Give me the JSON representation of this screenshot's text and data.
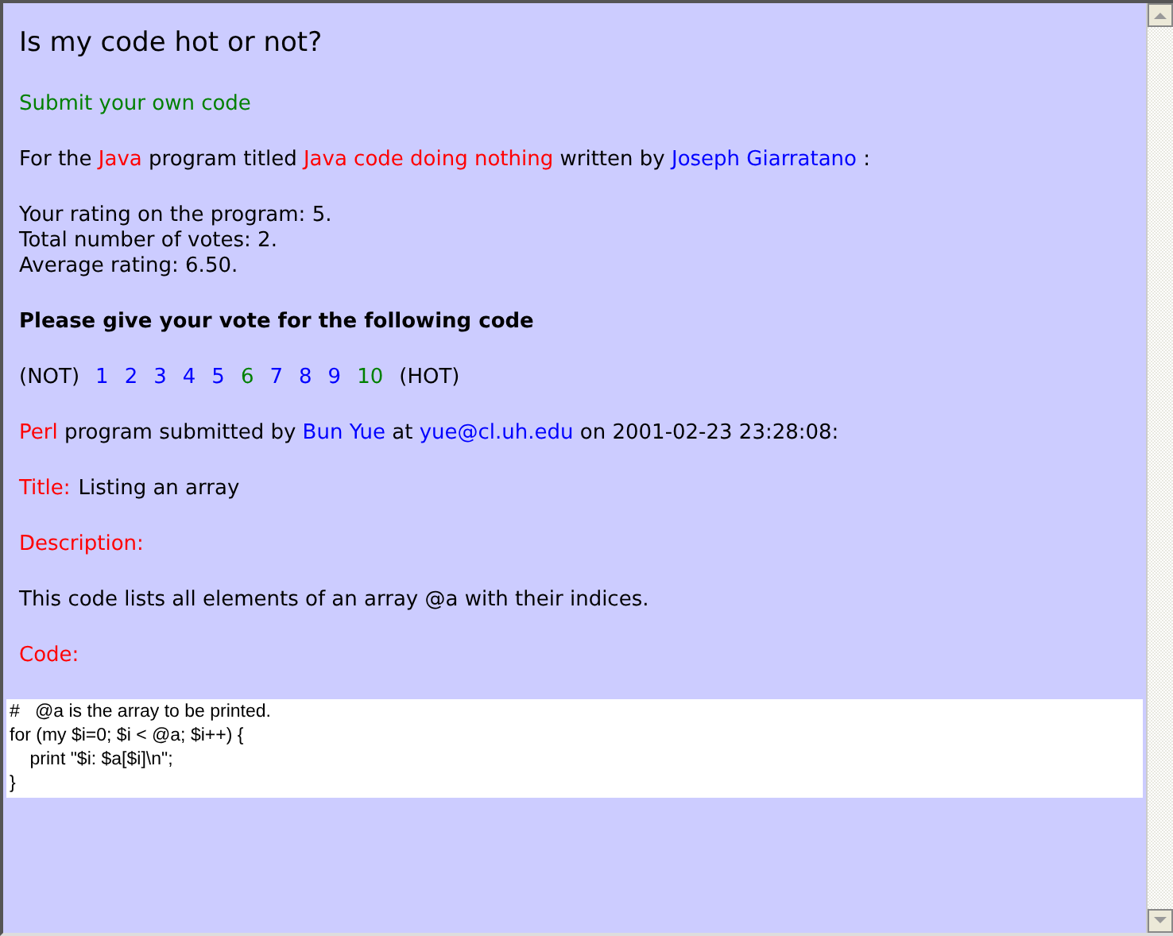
{
  "heading": "Is my code hot or not?",
  "submit_link": "Submit your own code",
  "intro": [
    {
      "kind": "text",
      "text": "For the "
    },
    {
      "kind": "red",
      "text": "Java"
    },
    {
      "kind": "text",
      "text": " program titled "
    },
    {
      "kind": "red",
      "text": "Java code doing nothing"
    },
    {
      "kind": "text",
      "text": " written by "
    },
    {
      "kind": "link",
      "text": "Joseph Giarratano"
    },
    {
      "kind": "text",
      "text": " :"
    }
  ],
  "stats": [
    "Your rating on the program: 5.",
    "Total number of votes: 2.",
    "Average rating: 6.50."
  ],
  "vote_prompt": "Please give your vote for the following code",
  "vote_low": "(NOT)",
  "votes": [
    {
      "label": "1",
      "color": "#0000ff"
    },
    {
      "label": "2",
      "color": "#0000ff"
    },
    {
      "label": "3",
      "color": "#0000ff"
    },
    {
      "label": "4",
      "color": "#0000ff"
    },
    {
      "label": "5",
      "color": "#0000ff"
    },
    {
      "label": "6",
      "color": "#008000"
    },
    {
      "label": "7",
      "color": "#0000ff"
    },
    {
      "label": "8",
      "color": "#0000ff"
    },
    {
      "label": "9",
      "color": "#0000ff"
    },
    {
      "label": "10",
      "color": "#008000"
    }
  ],
  "vote_high": "(HOT)",
  "submission": [
    {
      "kind": "red",
      "text": "Perl"
    },
    {
      "kind": "text",
      "text": " program submitted by "
    },
    {
      "kind": "link",
      "text": "Bun Yue"
    },
    {
      "kind": "text",
      "text": " at "
    },
    {
      "kind": "link",
      "text": "yue@cl.uh.edu"
    },
    {
      "kind": "text",
      "text": " on 2001-02-23 23:28:08:"
    }
  ],
  "title_label": "Title:",
  "title_value": "Listing an array",
  "description_label": "Description:",
  "description": "This code lists all elements of an array @a with their indices.",
  "code_label": "Code:",
  "code_lines": [
    "#   @a is the array to be printed.",
    "for (my $i=0; $i < @a; $i++) {",
    "    print \"$i: $a[$i]\\n\";",
    "}"
  ]
}
